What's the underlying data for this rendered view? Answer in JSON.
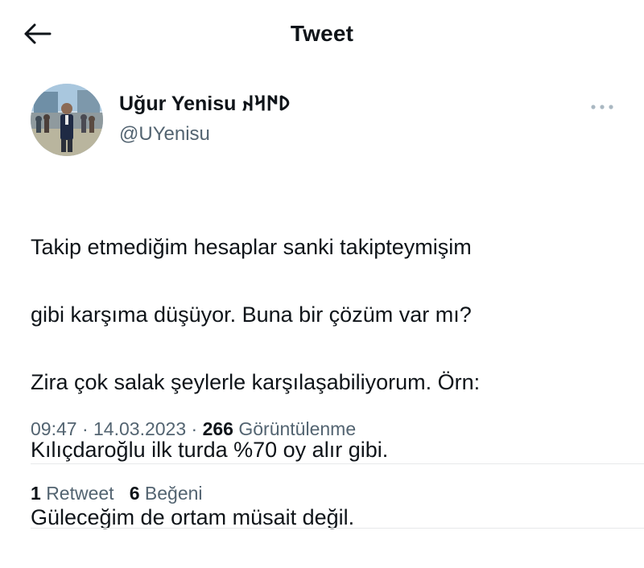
{
  "header": {
    "title": "Tweet",
    "back_icon": "arrow-left-icon"
  },
  "author": {
    "display_name": "Uğur Yenisu 𐰖𐰇𐰺𐰴",
    "handle": "@UYenisu",
    "avatar_icon": "profile-photo"
  },
  "more_icon": "more-horizontal-icon",
  "tweet": {
    "lines": [
      "Takip etmediğim hesaplar sanki takipteymişim",
      "gibi karşıma düşüyor. Buna bir çözüm var mı?",
      "Zira çok salak şeylerle karşılaşabiliyorum. Örn:",
      "Kılıçdaroğlu ilk turda %70 oy alır gibi.",
      "Güleceğim de ortam müsait değil."
    ]
  },
  "meta": {
    "time": "09:47",
    "date": "14.03.2023",
    "separator": "·",
    "views_count": "266",
    "views_label": "Görüntülenme"
  },
  "stats": {
    "retweets_count": "1",
    "retweets_label": "Retweet",
    "likes_count": "6",
    "likes_label": "Beğeni"
  },
  "colors": {
    "text": "#0f1419",
    "secondary": "#536471",
    "divider": "#e7e9ea"
  }
}
